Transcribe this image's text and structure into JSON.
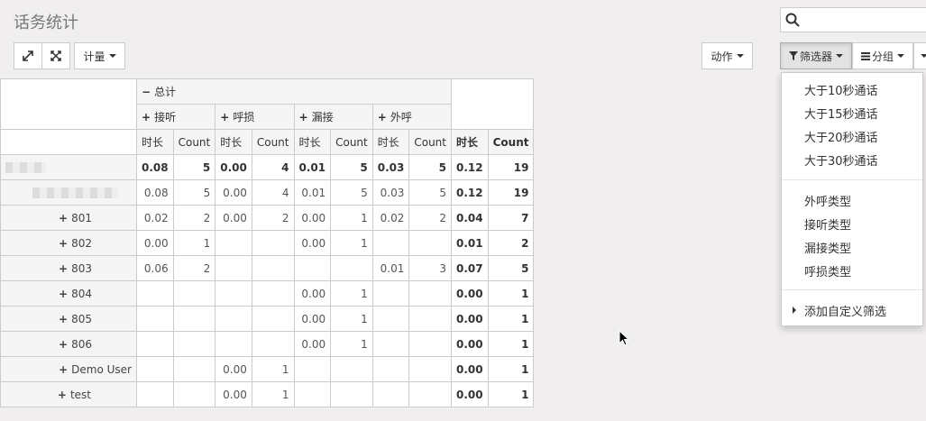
{
  "title": "话务统计",
  "search": {
    "placeholder": ""
  },
  "toolbar": {
    "measure_label": "计量",
    "action_label": "动作",
    "filter_label": "筛选器",
    "group_label": "分组"
  },
  "pivot": {
    "total_label": "总计",
    "groups": [
      "接听",
      "呼损",
      "漏接",
      "外呼"
    ],
    "sub_labels": {
      "duration": "时长",
      "count": "Count"
    },
    "rows": [
      {
        "label": "801",
        "cells": [
          "0.02",
          "2",
          "0.00",
          "2",
          "0.00",
          "1",
          "0.02",
          "2"
        ],
        "total": [
          "0.04",
          "7"
        ]
      },
      {
        "label": "802",
        "cells": [
          "0.00",
          "1",
          "",
          "",
          "0.00",
          "1",
          "",
          ""
        ],
        "total": [
          "0.01",
          "2"
        ]
      },
      {
        "label": "803",
        "cells": [
          "0.06",
          "2",
          "",
          "",
          "",
          "",
          "0.01",
          "3"
        ],
        "total": [
          "0.07",
          "5"
        ]
      },
      {
        "label": "804",
        "cells": [
          "",
          "",
          "",
          "",
          "0.00",
          "1",
          "",
          ""
        ],
        "total": [
          "0.00",
          "1"
        ]
      },
      {
        "label": "805",
        "cells": [
          "",
          "",
          "",
          "",
          "0.00",
          "1",
          "",
          ""
        ],
        "total": [
          "0.00",
          "1"
        ]
      },
      {
        "label": "806",
        "cells": [
          "",
          "",
          "",
          "",
          "0.00",
          "1",
          "",
          ""
        ],
        "total": [
          "0.00",
          "1"
        ]
      },
      {
        "label": "Demo User",
        "cells": [
          "",
          "",
          "0.00",
          "1",
          "",
          "",
          "",
          ""
        ],
        "total": [
          "0.00",
          "1"
        ]
      },
      {
        "label": "test",
        "cells": [
          "",
          "",
          "0.00",
          "1",
          "",
          "",
          "",
          ""
        ],
        "total": [
          "0.00",
          "1"
        ]
      }
    ],
    "total_row": {
      "cells": [
        "0.08",
        "5",
        "0.00",
        "4",
        "0.01",
        "5",
        "0.03",
        "5"
      ],
      "total": [
        "0.12",
        "19"
      ]
    },
    "sub_row": {
      "cells": [
        "0.08",
        "5",
        "0.00",
        "4",
        "0.01",
        "5",
        "0.03",
        "5"
      ],
      "total": [
        "0.12",
        "19"
      ]
    }
  },
  "filter_menu": {
    "group1": [
      "大于10秒通话",
      "大于15秒通话",
      "大于20秒通话",
      "大于30秒通话"
    ],
    "group2": [
      "外呼类型",
      "接听类型",
      "漏接类型",
      "呼损类型"
    ],
    "custom": "添加自定义筛选"
  }
}
